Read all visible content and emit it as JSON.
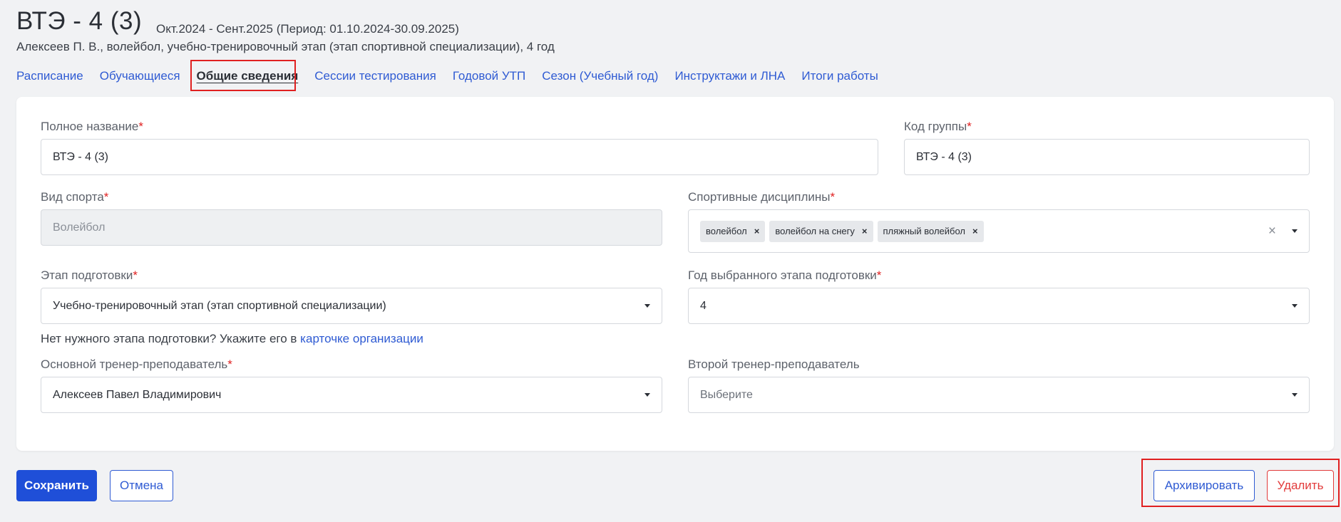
{
  "header": {
    "title": "ВТЭ - 4 (3)",
    "period": "Окт.2024 - Сент.2025 (Период: 01.10.2024-30.09.2025)",
    "subtitle": "Алексеев П. В., волейбол, учебно-тренировочный этап (этап спортивной специализации), 4 год"
  },
  "tabs": [
    {
      "label": "Расписание"
    },
    {
      "label": "Обучающиеся"
    },
    {
      "label": "Общие сведения",
      "active": true
    },
    {
      "label": "Сессии тестирования"
    },
    {
      "label": "Годовой УТП"
    },
    {
      "label": "Сезон (Учебный год)"
    },
    {
      "label": "Инструктажи и ЛНА"
    },
    {
      "label": "Итоги работы"
    }
  ],
  "form": {
    "full_name": {
      "label": "Полное название",
      "required_mark": "*",
      "value": "ВТЭ - 4 (3)"
    },
    "group_code": {
      "label": "Код группы",
      "required_mark": "*",
      "value": "ВТЭ - 4 (3)"
    },
    "sport": {
      "label": "Вид спорта",
      "required_mark": "*",
      "value": "Волейбол"
    },
    "disciplines": {
      "label": "Спортивные дисциплины",
      "required_mark": "*",
      "tags": [
        "волейбол",
        "волейбол на снегу",
        "пляжный волейбол"
      ],
      "tag_remove": "×",
      "clear": "×"
    },
    "stage": {
      "label": "Этап подготовки",
      "required_mark": "*",
      "value": "Учебно-тренировочный этап (этап спортивной специализации)"
    },
    "stage_year": {
      "label": "Год выбранного этапа подготовки",
      "required_mark": "*",
      "value": "4"
    },
    "hint": {
      "text": "Нет нужного этапа подготовки? Укажите его в ",
      "link": "карточке организации"
    },
    "main_coach": {
      "label": "Основной тренер-преподаватель",
      "required_mark": "*",
      "value": "Алексеев Павел Владимирович"
    },
    "second_coach": {
      "label": "Второй тренер-преподаватель",
      "placeholder": "Выберите"
    }
  },
  "actions": {
    "save": "Сохранить",
    "cancel": "Отмена",
    "archive": "Архивировать",
    "delete": "Удалить"
  },
  "colors": {
    "accent": "#1f4fd8",
    "link": "#2f5bd3",
    "danger": "#e23b3b",
    "highlight": "#e02020"
  }
}
